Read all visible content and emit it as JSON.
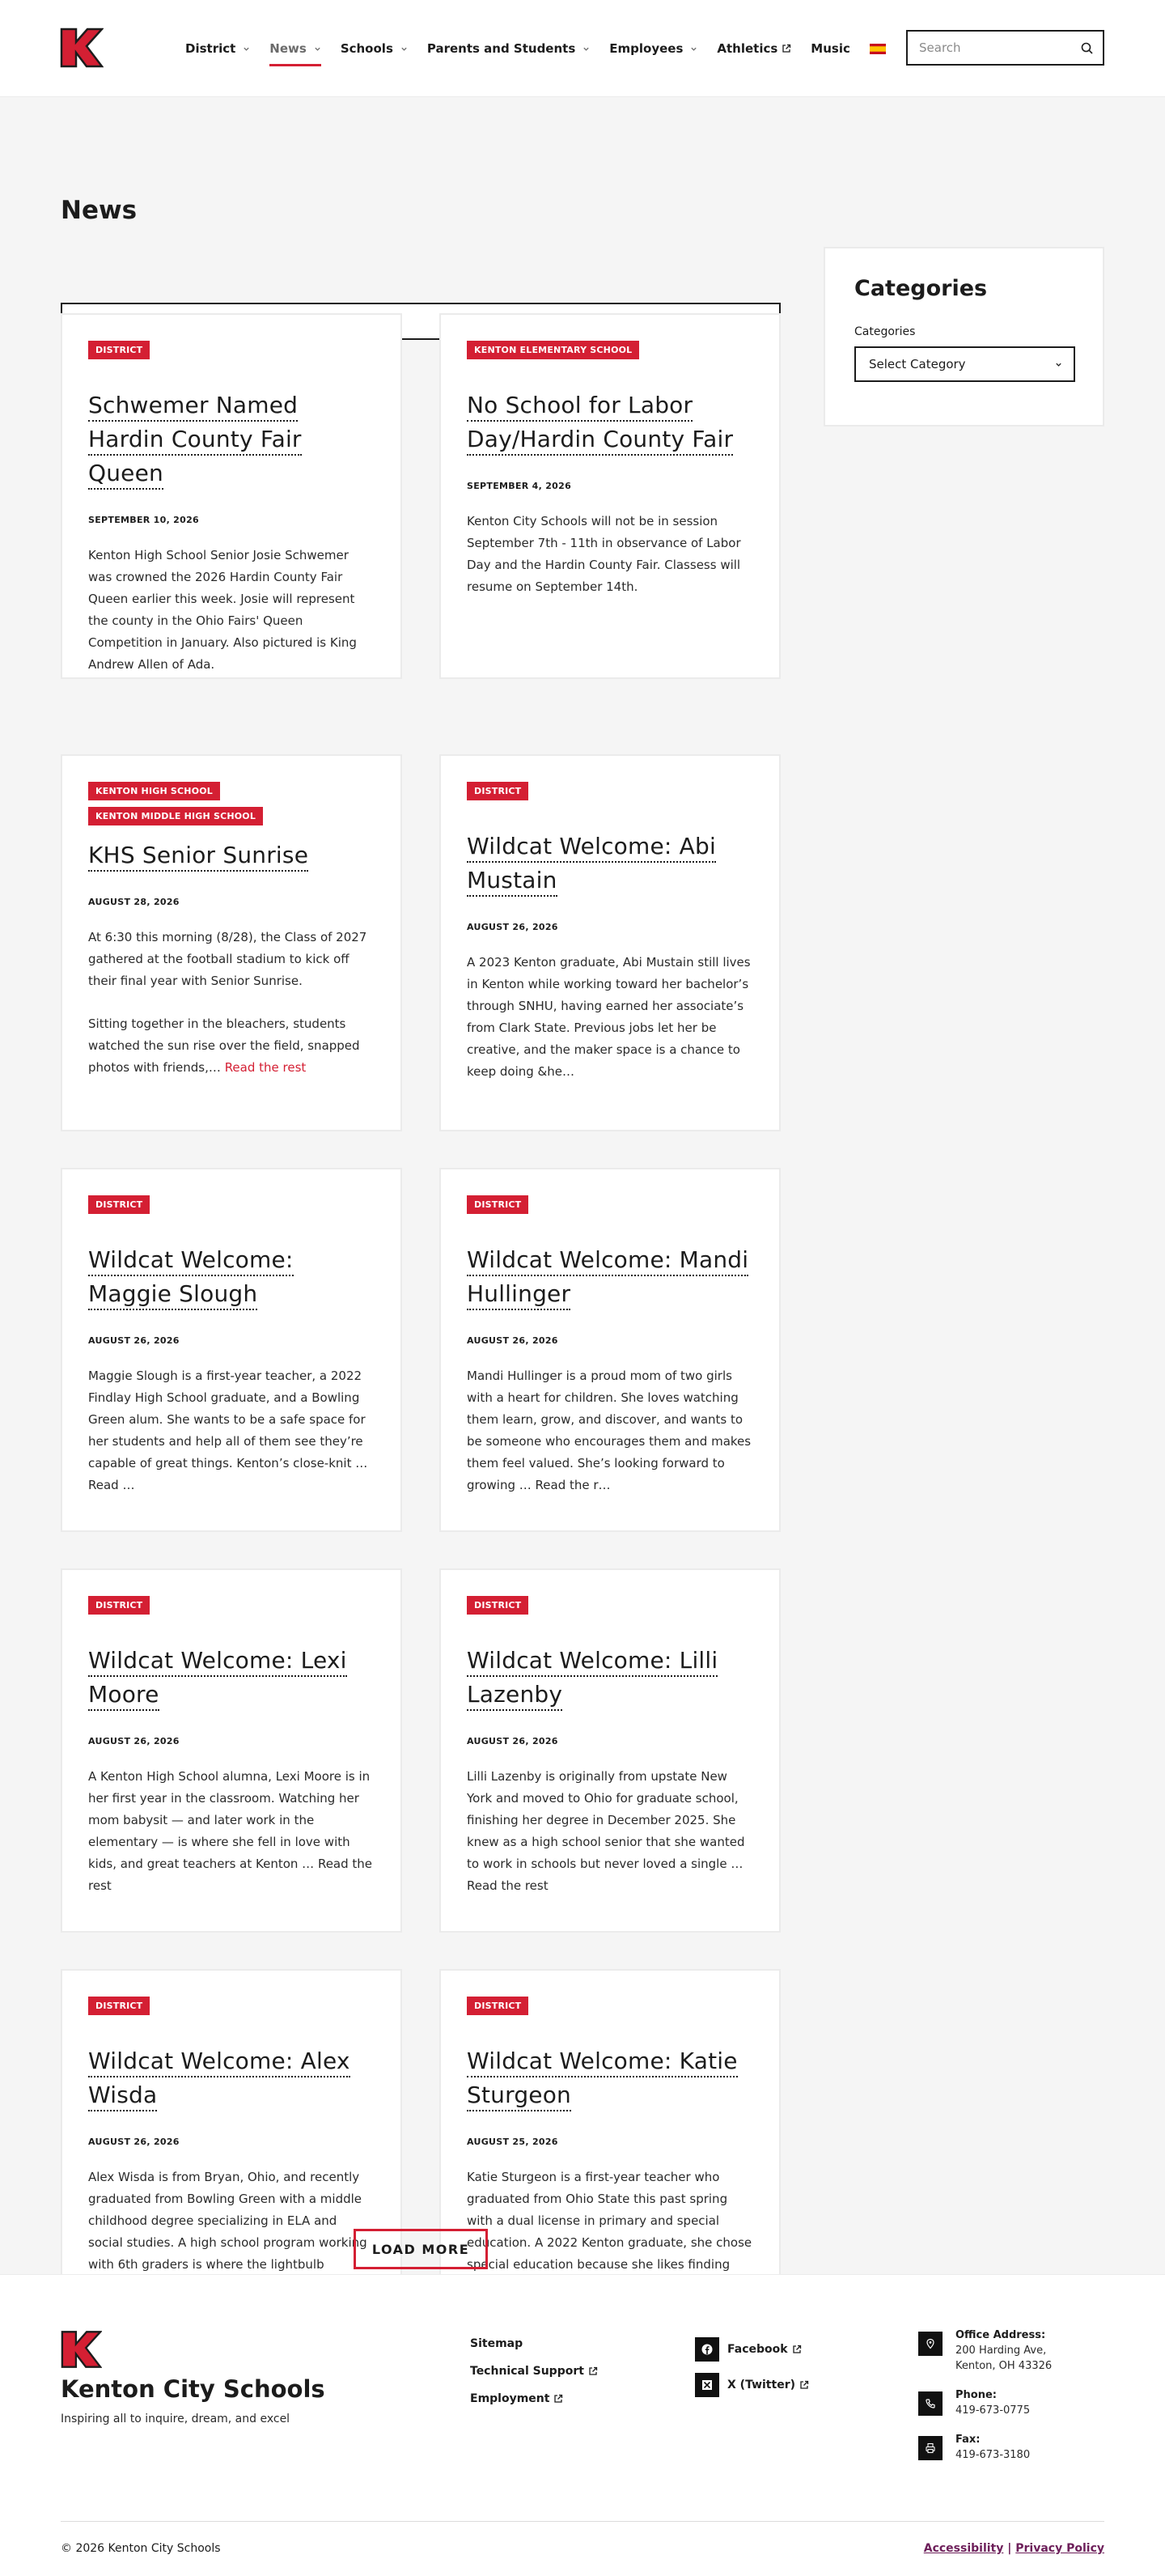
{
  "brand": {
    "name": "Kenton City Schools",
    "tagline": "Inspiring all to inquire, dream, and excel",
    "logo_letter": "K",
    "primary_color": "#d41f33",
    "accent_link_color": "#6d1f5a"
  },
  "nav": {
    "items": [
      {
        "label": "District",
        "dropdown": true
      },
      {
        "label": "News",
        "dropdown": true,
        "active": true
      },
      {
        "label": "Schools",
        "dropdown": true
      },
      {
        "label": "Parents and Students",
        "dropdown": true
      },
      {
        "label": "Employees",
        "dropdown": true
      },
      {
        "label": "Athletics",
        "external": true
      },
      {
        "label": "Music"
      }
    ],
    "language_icon": "spain-flag-icon"
  },
  "header_search": {
    "placeholder": "Search"
  },
  "page": {
    "title": "News",
    "search_placeholder": "Search",
    "load_more_label": "LOAD MORE"
  },
  "sidebar": {
    "title": "Categories",
    "select_label": "Categories",
    "select_value": "Select Category"
  },
  "posts": [
    {
      "tags": [
        "DISTRICT"
      ],
      "title": "Schwemer Named Hardin County Fair Queen",
      "date": "SEPTEMBER 10, 2026",
      "excerpt": [
        "Kenton High School Senior Josie Schwemer was crowned the 2026 Hardin County Fair Queen earlier this week. Josie will represent the county in the Ohio Fairs' Queen Competition in January. Also pictured is King Andrew Allen of Ada."
      ]
    },
    {
      "tags": [
        "KENTON ELEMENTARY SCHOOL"
      ],
      "title": "No School for Labor Day/Hardin County Fair",
      "date": "SEPTEMBER 4, 2026",
      "excerpt": [
        "Kenton City Schools will not be in session September 7th - 11th in observance of Labor Day and the Hardin County Fair. Classess will resume on September 14th."
      ]
    },
    {
      "tags": [
        "KENTON HIGH SCHOOL",
        "KENTON MIDDLE HIGH SCHOOL"
      ],
      "title": "KHS Senior Sunrise",
      "date": "AUGUST 28, 2026",
      "excerpt": [
        "At 6:30 this morning (8/28), the Class of 2027 gathered at the football stadium to kick off their final year with Senior Sunrise.",
        "Sitting together in the bleachers, students watched the sun rise over the field, snapped photos with friends,…"
      ],
      "read_more": "Read the rest"
    },
    {
      "tags": [
        "DISTRICT"
      ],
      "title": "Wildcat Welcome: Abi Mustain",
      "date": "AUGUST 26, 2026",
      "excerpt": [
        "A 2023 Kenton graduate, Abi Mustain still lives in Kenton while working toward her bachelor’s through SNHU, having earned her associate’s from Clark State. Previous jobs let her be creative, and the maker space is a chance to keep doing &he…"
      ]
    },
    {
      "tags": [
        "DISTRICT"
      ],
      "title": "Wildcat Welcome: Maggie Slough",
      "date": "AUGUST 26, 2026",
      "excerpt": [
        "Maggie Slough is a first-year teacher, a 2022 Findlay High School graduate, and a Bowling Green alum. She wants to be a safe space for her students and help all of them see they’re capable of great things. Kenton’s close-knit … Read …"
      ]
    },
    {
      "tags": [
        "DISTRICT"
      ],
      "title": "Wildcat Welcome: Mandi Hullinger",
      "date": "AUGUST 26, 2026",
      "excerpt": [
        "Mandi Hullinger is a proud mom of two girls with a heart for children. She loves watching them learn, grow, and discover, and wants to be someone who encourages them and makes them feel valued. She’s looking forward to growing … Read the r…"
      ]
    },
    {
      "tags": [
        "DISTRICT"
      ],
      "title": "Wildcat Welcome: Lexi Moore",
      "date": "AUGUST 26, 2026",
      "excerpt": [
        "A Kenton High School alumna, Lexi Moore is in her first year in the classroom. Watching her mom babysit — and later work in the elementary — is where she fell in love with kids, and great teachers at Kenton … Read the rest"
      ]
    },
    {
      "tags": [
        "DISTRICT"
      ],
      "title": "Wildcat Welcome: Lilli Lazenby",
      "date": "AUGUST 26, 2026",
      "excerpt": [
        "Lilli Lazenby is originally from upstate New York and moved to Ohio for graduate school, finishing her degree in December 2025. She knew as a high school senior that she wanted to work in schools but never loved a single … Read the rest"
      ]
    },
    {
      "tags": [
        "DISTRICT"
      ],
      "title": "Wildcat Welcome: Alex Wisda",
      "date": "AUGUST 26, 2026",
      "excerpt": [
        "Alex Wisda is from Bryan, Ohio, and recently graduated from Bowling Green with a middle childhood degree specializing in ELA and social studies. A high school program working with 6th graders is where the lightbulb moment became the whole point. &helli…"
      ]
    },
    {
      "tags": [
        "DISTRICT"
      ],
      "title": "Wildcat Welcome: Katie Sturgeon",
      "date": "AUGUST 25, 2026",
      "excerpt": [
        "Katie Sturgeon is a first-year teacher who graduated from Ohio State this past spring with a dual license in primary and special education. A 2022 Kenton graduate, she chose special education because she likes finding different ways to approach a &hell…"
      ]
    }
  ],
  "footer": {
    "links": [
      {
        "label": "Sitemap"
      },
      {
        "label": "Technical Support",
        "external": true
      },
      {
        "label": "Employment",
        "external": true
      }
    ],
    "social": [
      {
        "label": "Facebook",
        "icon": "facebook-icon"
      },
      {
        "label": "X (Twitter)",
        "icon": "x-twitter-icon"
      }
    ],
    "contact": [
      {
        "label": "Office Address:",
        "value": [
          "200 Harding Ave,",
          "Kenton, OH 43326"
        ],
        "icon": "location-pin-icon"
      },
      {
        "label": "Phone:",
        "value": [
          "419-673-0775"
        ],
        "icon": "phone-icon"
      },
      {
        "label": "Fax:",
        "value": [
          "419-673-3180"
        ],
        "icon": "fax-icon"
      }
    ],
    "copyright": "© 2026 Kenton City Schools",
    "legal": {
      "accessibility": "Accessibility",
      "separator": "|",
      "privacy": "Privacy Policy"
    }
  }
}
